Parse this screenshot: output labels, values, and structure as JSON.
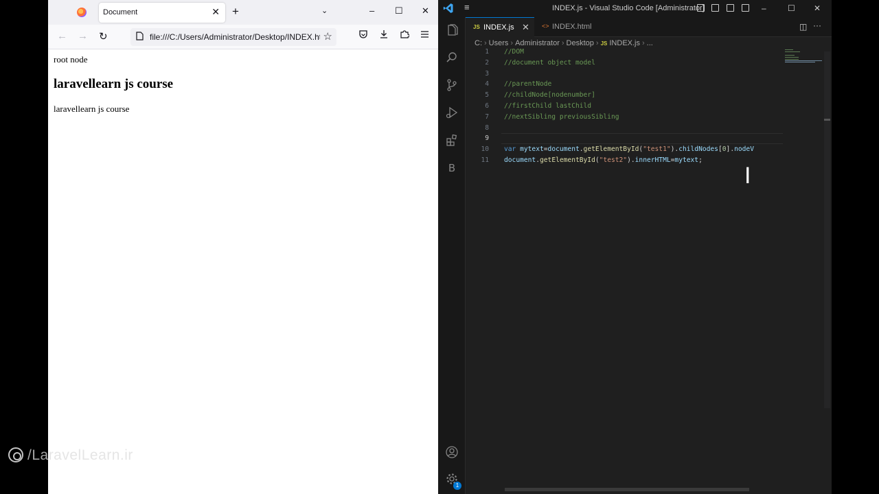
{
  "browser": {
    "tab": {
      "title": "Document",
      "close_glyph": "✕"
    },
    "new_tab_glyph": "+",
    "list_tabs_glyph": "⌄",
    "window_buttons": {
      "minimize": "–",
      "maximize": "☐",
      "close": "✕"
    },
    "nav": {
      "back": "←",
      "forward": "→",
      "reload": "↻"
    },
    "url": "file:///C:/Users/Administrator/Desktop/INDEX.html",
    "toolbar_icons": [
      "shield-icon",
      "download-icon",
      "extensions-icon",
      "menu-icon"
    ],
    "page": {
      "paragraph1": "root node",
      "heading": "laravellearn js course",
      "paragraph2": "laravellearn js course"
    }
  },
  "watermark": "/LaravelLearn.ir",
  "vscode": {
    "title": "INDEX.js - Visual Studio Code [Administrator]",
    "menu_glyph": "≡",
    "window_buttons": {
      "minimize": "–",
      "maximize": "☐",
      "close": "✕"
    },
    "activity_bar": [
      "explorer-icon",
      "search-icon",
      "source-control-icon",
      "run-debug-icon",
      "extensions-icon",
      "b-extension-icon"
    ],
    "activity_b_label": "B",
    "accounts_badge": "1",
    "tabs": [
      {
        "label": "INDEX.js",
        "badge": "JS",
        "active": true,
        "close_glyph": "✕"
      },
      {
        "label": "INDEX.html",
        "badge": "<>",
        "active": false
      }
    ],
    "tab_actions": {
      "split": "◫",
      "more": "···"
    },
    "breadcrumb": [
      "C:",
      "Users",
      "Administrator",
      "Desktop",
      "INDEX.js",
      "..."
    ],
    "breadcrumb_sep": "›",
    "breadcrumb_js_badge": "JS",
    "current_line": 9,
    "code_lines": [
      {
        "n": "1",
        "t": "//DOM"
      },
      {
        "n": "2",
        "t": "//document object model"
      },
      {
        "n": "3",
        "t": ""
      },
      {
        "n": "4",
        "t": "//parentNode"
      },
      {
        "n": "5",
        "t": "//childNode[nodenumber]"
      },
      {
        "n": "6",
        "t": "//firstChild lastChild"
      },
      {
        "n": "7",
        "t": "//nextSibling previousSibling"
      },
      {
        "n": "8",
        "t": ""
      },
      {
        "n": "9",
        "t": ""
      },
      {
        "n": "10",
        "t": "var mytext=document.getElementById(\"test1\").childNodes[0].nodeV"
      },
      {
        "n": "11",
        "t": "document.getElementById(\"test2\").innerHTML=mytext;"
      }
    ]
  },
  "colors": {
    "vscode_bg": "#1f1f1f",
    "vscode_chrome": "#181818",
    "accent": "#0078d4",
    "comment": "#6a9955",
    "keyword": "#569cd6",
    "function": "#dcdcaa",
    "string": "#ce9178",
    "variable": "#9cdcfe"
  }
}
